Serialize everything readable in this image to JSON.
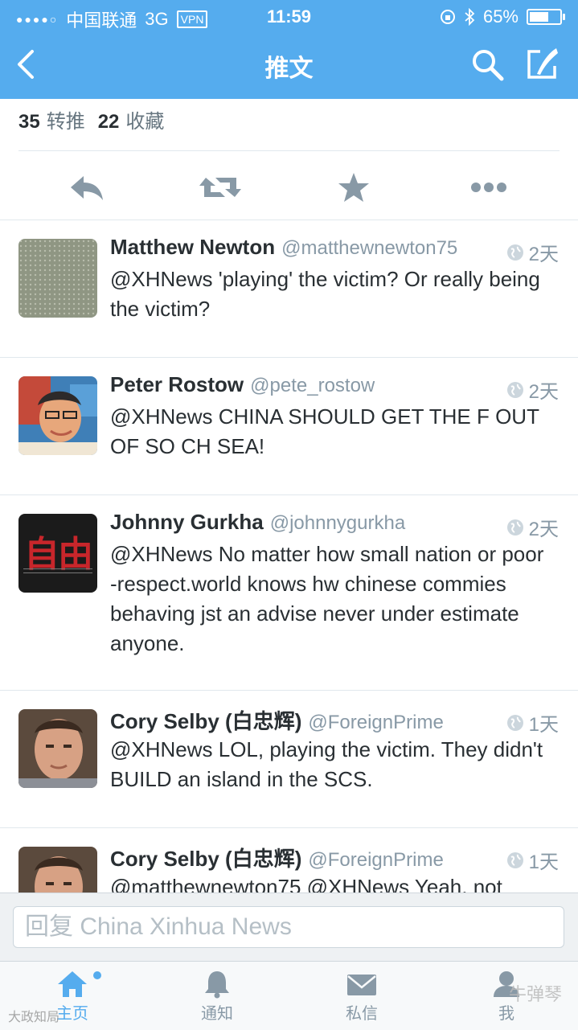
{
  "status_bar": {
    "carrier": "中国联通",
    "network": "3G",
    "vpn": "VPN",
    "time": "11:59",
    "battery": "65%",
    "battery_level": 0.65
  },
  "nav": {
    "title": "推文",
    "back_icon": "chevron-left-icon",
    "search_icon": "search-icon",
    "compose_icon": "compose-icon"
  },
  "stats": {
    "retweets_count": "35",
    "retweets_label": "转推",
    "favorites_count": "22",
    "favorites_label": "收藏"
  },
  "actions": [
    "reply-icon",
    "retweet-icon",
    "favorite-icon",
    "more-icon"
  ],
  "tweets": [
    {
      "name": "Matthew Newton",
      "handle": "@matthewnewton75",
      "time": "2天",
      "text": "@XHNews 'playing' the victim? Or really being the victim?"
    },
    {
      "name": "Peter Rostow",
      "handle": "@pete_rostow",
      "time": "2天",
      "text": "@XHNews CHINA SHOULD GET THE F OUT OF SO CH SEA!"
    },
    {
      "name": "Johnny Gurkha",
      "handle": "@johnnygurkha",
      "time": "2天",
      "text": "@XHNews No matter how small nation or poor -respect.world knows hw chinese commies behaving jst an advise never under estimate anyone.",
      "avatar_text": "自由"
    },
    {
      "name": "Cory Selby (白忠辉)",
      "handle": "@ForeignPrime",
      "time": "1天",
      "text": "@XHNews LOL, playing the victim. They didn't BUILD an island in the SCS."
    },
    {
      "name": "Cory Selby (白忠辉)",
      "handle": "@ForeignPrime",
      "time": "1天",
      "text": "@matthewnewton75 @XHNews Yeah, not"
    }
  ],
  "reply": {
    "placeholder": "回复 China Xinhua News"
  },
  "tabs": [
    {
      "label": "主页",
      "icon": "home-icon",
      "active": true
    },
    {
      "label": "通知",
      "icon": "bell-icon",
      "active": false
    },
    {
      "label": "私信",
      "icon": "envelope-icon",
      "active": false
    },
    {
      "label": "我",
      "icon": "user-icon",
      "active": false
    }
  ],
  "watermarks": {
    "left": "大政知局",
    "right": "牛弹琴"
  },
  "colors": {
    "brand": "#55acee",
    "text": "#292f33",
    "muted": "#8899a6"
  }
}
